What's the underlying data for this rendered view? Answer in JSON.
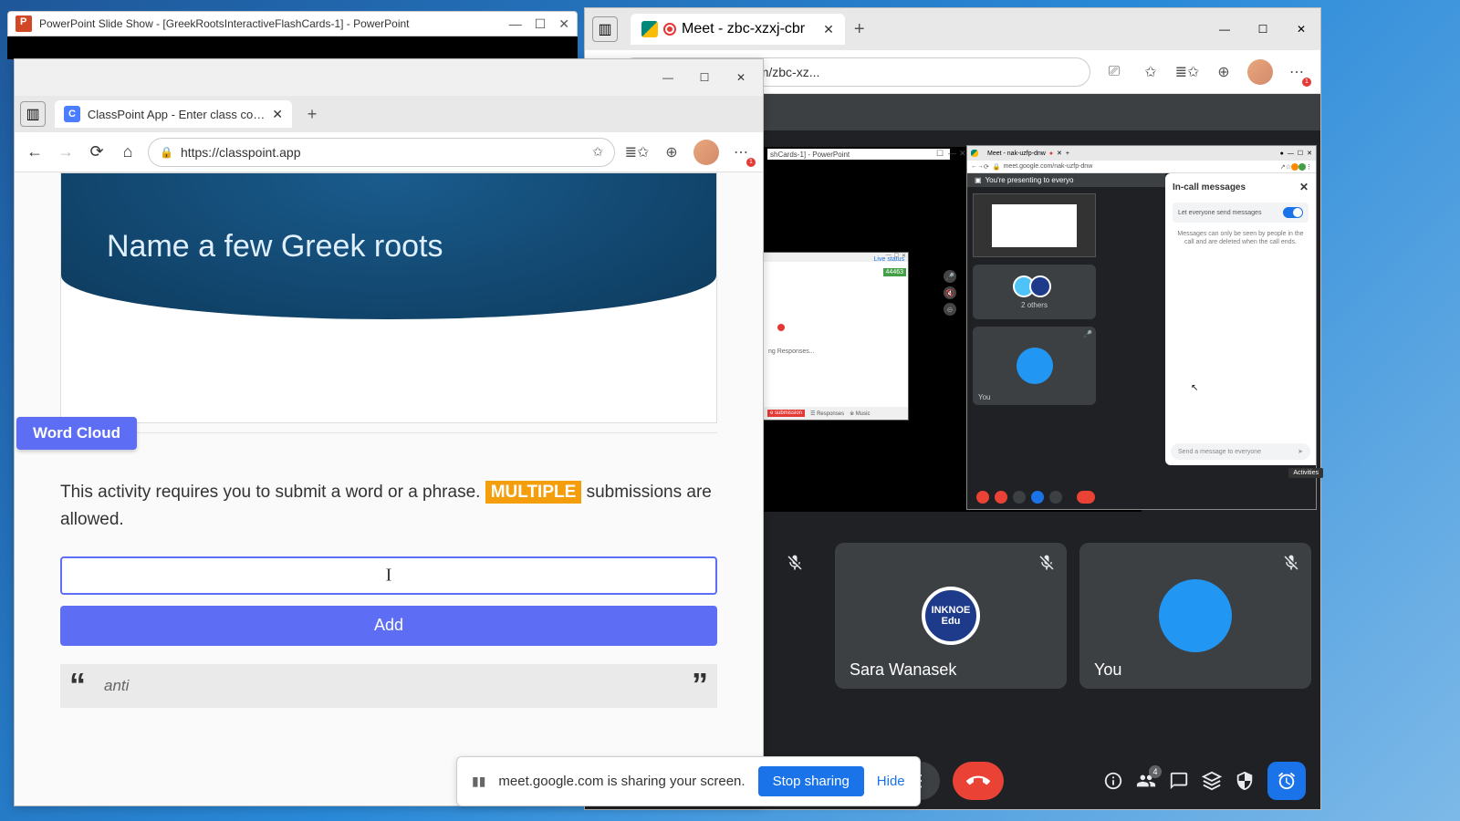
{
  "pp": {
    "title": "PowerPoint Slide Show - [GreekRootsInteractiveFlashCards-1] - PowerPoint"
  },
  "edge_left": {
    "tab_title": "ClassPoint App - Enter class code",
    "url": "https://classpoint.app"
  },
  "classpoint": {
    "slide_title": "Name a few Greek roots",
    "badge": "Word Cloud",
    "instruction_pre": "This activity requires you to submit a word or a phrase. ",
    "instruction_mult": "MULTIPLE",
    "instruction_post": " submissions are allowed.",
    "add_label": "Add",
    "sample_answer": "anti"
  },
  "share_bar": {
    "text": "meet.google.com is sharing your screen.",
    "stop": "Stop sharing",
    "hide": "Hide"
  },
  "edge_right": {
    "tab_title": "Meet - zbc-xzxj-cbr",
    "url": "https://meet.google.com/zbc-xz..."
  },
  "inner": {
    "pp_title": "shCards-1] - PowerPoint",
    "meet_tab": "Meet - nak-uzfp-dnw",
    "meet_url": "meet.google.com/nak-uzfp-dnw",
    "presenting": "You're presenting to everyo",
    "code": "44463",
    "live_status": "Live status",
    "responses_text": "ng Responses...",
    "submission": "e submission",
    "responses": "Responses",
    "music": "Music",
    "others_count": "2 others",
    "you": "You",
    "chat_title": "In-call messages",
    "toggle_label": "Let everyone send messages",
    "chat_note": "Messages can only be seen by people in the call and are deleted when the call ends.",
    "chat_placeholder": "Send a message to everyone",
    "activities": "Activities"
  },
  "meet": {
    "tile1_name": "Sara Wanasek",
    "tile1_avatar": "INKNOE Edu",
    "tile2_name": "You",
    "people_count": "4"
  }
}
